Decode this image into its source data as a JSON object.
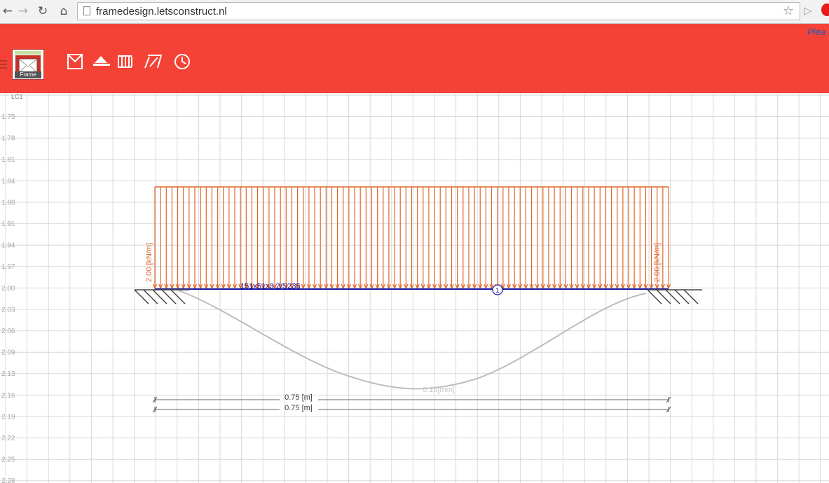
{
  "browser": {
    "back_icon": "arrow-left-icon",
    "forward_icon": "arrow-right-icon",
    "reload_icon": "reload-icon",
    "home_icon": "home-icon",
    "url": "framedesign.letsconstruct.nl",
    "bookmark_icon": "star-icon"
  },
  "app": {
    "brand_color": "#f44336",
    "logo_label": "Frame",
    "toolbar": [
      {
        "name": "frame-tool",
        "icon": "frame-icon"
      },
      {
        "name": "support-tool",
        "icon": "support-icon"
      },
      {
        "name": "load-tool",
        "icon": "distributed-load-icon"
      },
      {
        "name": "section-tool",
        "icon": "section-icon"
      },
      {
        "name": "history-tool",
        "icon": "clock-icon"
      }
    ],
    "header_edge_text": "Plea"
  },
  "canvas": {
    "load_case": "LC1",
    "y_scale": [
      "1.75",
      "1.78",
      "1.81",
      "1.84",
      "1.88",
      "1.91",
      "1.94",
      "1.97",
      "2.00",
      "2.03",
      "2.06",
      "2.09",
      "2.13",
      "2.16",
      "2.19",
      "2.22",
      "2.25",
      "2.28"
    ],
    "load_left_label": "2.00 [kN/m]",
    "load_right_label": "2.00 [kN/m]",
    "load_color": "#e0662a",
    "beam_section_label": "151x51x3.2/S235",
    "beam_color": "#1a1aa8",
    "node_label": "1",
    "deflection_label": "0.10[mm]",
    "dimension_1": "0.75 [m]",
    "dimension_2": "0.75 [m]"
  }
}
